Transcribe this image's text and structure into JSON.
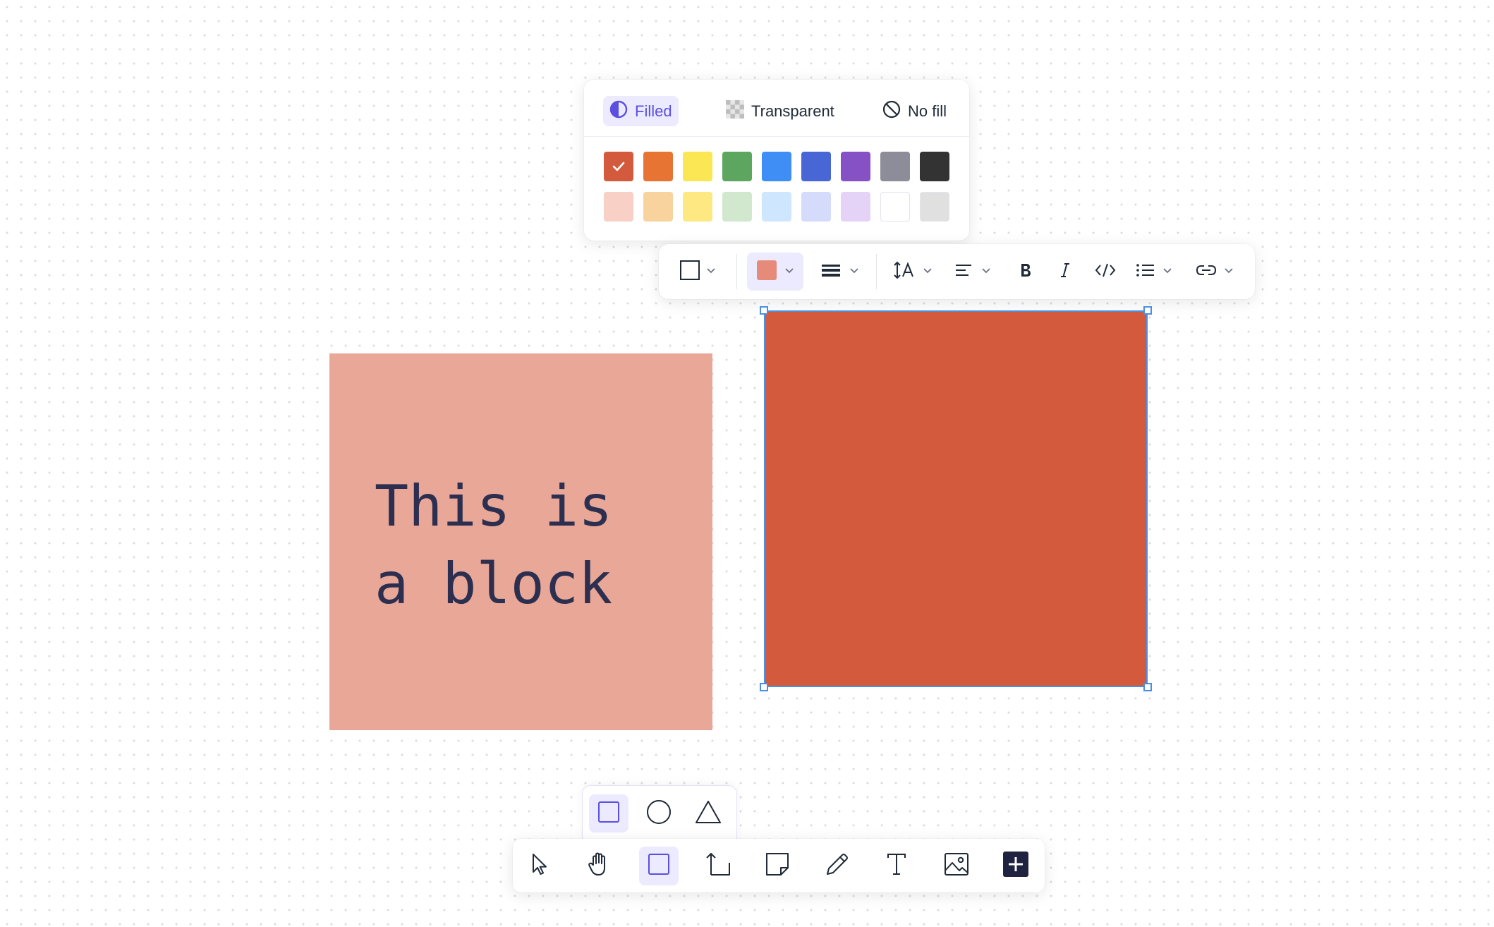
{
  "fill_popover": {
    "tabs": [
      {
        "label": "Filled",
        "icon": "half-circle-icon",
        "active": true
      },
      {
        "label": "Transparent",
        "icon": "checkerboard-icon",
        "active": false
      },
      {
        "label": "No fill",
        "icon": "no-fill-icon",
        "active": false
      }
    ],
    "swatches_row1": [
      "#d45a3d",
      "#e77433",
      "#fbe653",
      "#5da660",
      "#3f8ef5",
      "#4866d6",
      "#8651c4",
      "#8d8d99",
      "#333333"
    ],
    "swatches_row2": [
      "#f8d0c5",
      "#f8d39d",
      "#fde882",
      "#d1e8cf",
      "#cfe7fe",
      "#d5dcfb",
      "#e5d3f7",
      "#ffffff",
      "#e0e0e0"
    ],
    "selected_swatch": "#d45a3d"
  },
  "format_toolbar": {
    "items": [
      "shape-border-icon",
      "fill-color-icon",
      "stroke-width-icon",
      "text-size-icon",
      "text-align-icon",
      "bold-icon",
      "italic-icon",
      "code-icon",
      "list-icon",
      "link-icon"
    ],
    "fill_color": "#e68a7a"
  },
  "canvas": {
    "text_block": {
      "text": "This is\na block",
      "color": "#e8a797"
    },
    "selected_block": {
      "color": "#d45a3d"
    }
  },
  "shape_picker": {
    "shapes": [
      "rectangle-icon",
      "circle-icon",
      "triangle-icon"
    ],
    "active": "rectangle-icon"
  },
  "main_toolbar": {
    "tools": [
      "select-icon",
      "hand-icon",
      "shape-icon",
      "connector-icon",
      "sticky-note-icon",
      "pen-icon",
      "text-icon",
      "image-icon",
      "add-icon"
    ],
    "active": "shape-icon"
  }
}
